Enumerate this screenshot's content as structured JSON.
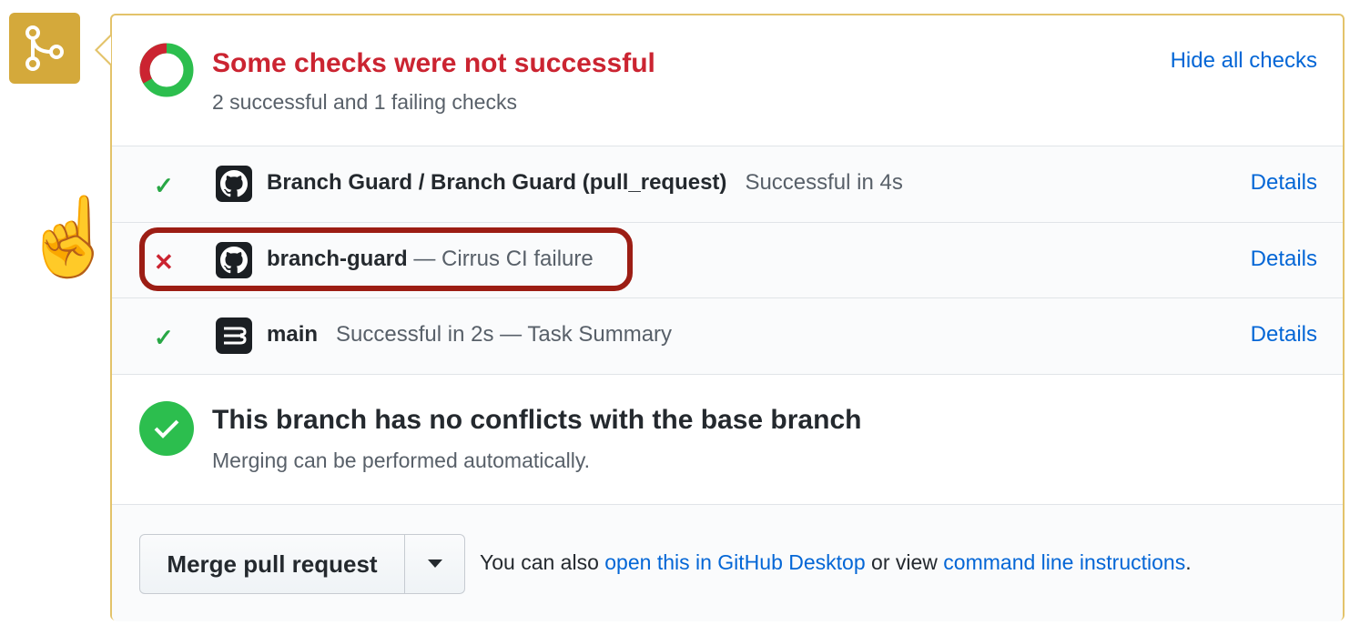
{
  "sidebar": {
    "badge_icon": "git-merge-icon",
    "pointer_emoji": "☝️"
  },
  "header": {
    "title": "Some checks were not successful",
    "summary": "2 successful and 1 failing checks",
    "hide_checks_label": "Hide all checks",
    "progress": {
      "successful": 2,
      "failing": 1
    }
  },
  "checks": [
    {
      "status": "success",
      "status_glyph": "✓",
      "avatar_icon": "github-icon",
      "name": "Branch Guard / Branch Guard (pull_request)",
      "description": "Successful in 4s",
      "details_label": "Details"
    },
    {
      "status": "failure",
      "status_glyph": "✕",
      "avatar_icon": "github-icon",
      "name": "branch-guard",
      "description": "— Cirrus CI failure",
      "details_label": "Details"
    },
    {
      "status": "success",
      "status_glyph": "✓",
      "avatar_icon": "cirrus-ci-icon",
      "name": "main",
      "description": "Successful in 2s — Task Summary",
      "details_label": "Details"
    }
  ],
  "merge_state": {
    "title": "This branch has no conflicts with the base branch",
    "subtitle": "Merging can be performed automatically."
  },
  "footer": {
    "merge_button_label": "Merge pull request",
    "text_prefix": "You can also",
    "desktop_link": "open this in GitHub Desktop",
    "text_middle": "or view",
    "cli_link": "command line instructions",
    "text_suffix": "."
  },
  "colors": {
    "success": "#28a745",
    "failure": "#cb2431",
    "link": "#0366d6",
    "badge": "#d4a93b",
    "highlight": "#9c1d14"
  }
}
